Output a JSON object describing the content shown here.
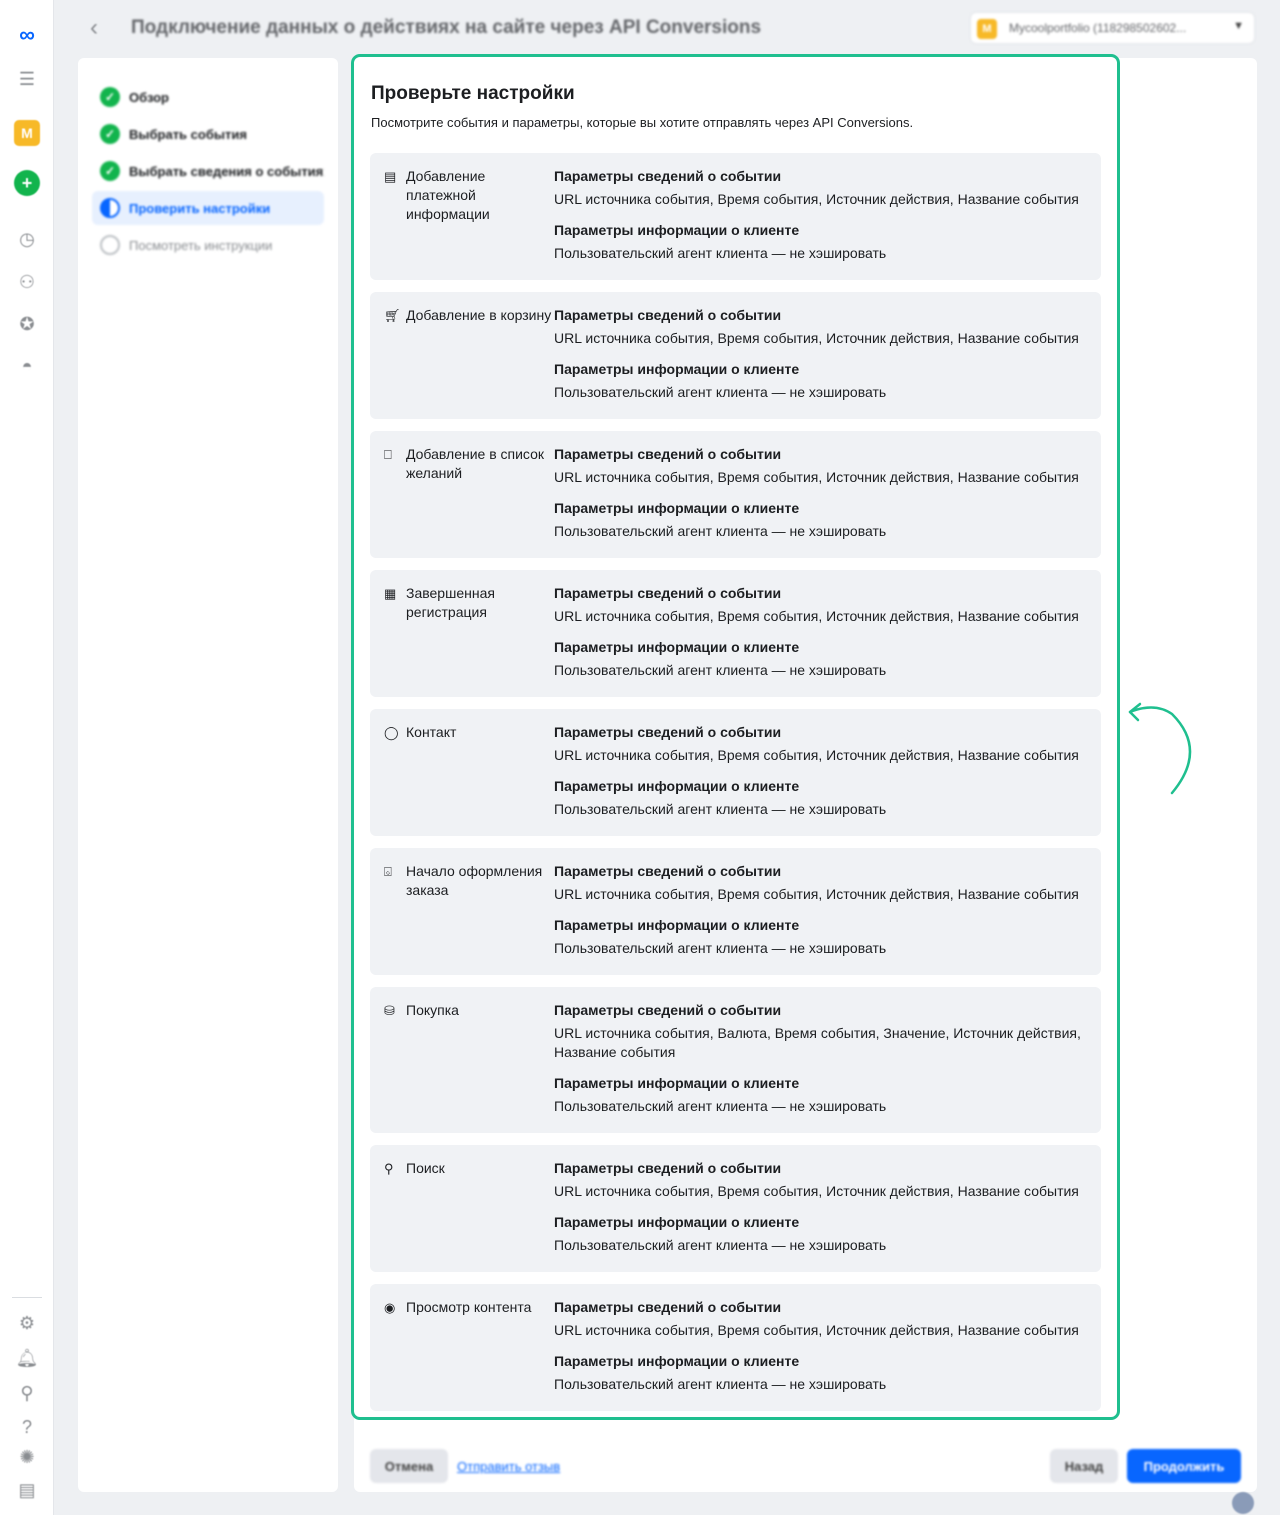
{
  "header": {
    "title": "Подключение данных о действиях на сайте через API Conversions",
    "account_badge": "M",
    "account_name": "Mycoolportfolio (118298502602..."
  },
  "rail": {
    "logo": "∞",
    "account_initial": "M",
    "icons": [
      "menu-icon",
      "clock-icon",
      "network-icon",
      "star-icon",
      "hat-icon",
      "gear-icon",
      "bell-icon",
      "search-icon",
      "help-icon",
      "bug-icon",
      "panel-icon"
    ]
  },
  "steps": [
    {
      "label": "Обзор",
      "state": "done"
    },
    {
      "label": "Выбрать события",
      "state": "done"
    },
    {
      "label": "Выбрать сведения о событиях",
      "state": "done"
    },
    {
      "label": "Проверить настройки",
      "state": "active"
    },
    {
      "label": "Посмотреть инструкции",
      "state": "todo"
    }
  ],
  "panel": {
    "title": "Проверьте настройки",
    "subtitle": "Посмотрите события и параметры, которые вы хотите отправлять через API Conversions."
  },
  "events": [
    {
      "name": "Добавление платежной информации",
      "icon": "card-icon",
      "event_params_label": "Параметры сведений о событии",
      "event_params": "URL источника события, Время события, Источник действия, Название события",
      "customer_params_label": "Параметры информации о клиенте",
      "customer_params": "Пользовательский агент клиента — не хэшировать"
    },
    {
      "name": "Добавление в корзину",
      "icon": "cart-icon",
      "event_params_label": "Параметры сведений о событии",
      "event_params": "URL источника события, Время события, Источник действия, Название события",
      "customer_params_label": "Параметры информации о клиенте",
      "customer_params": "Пользовательский агент клиента — не хэшировать"
    },
    {
      "name": "Добавление в список желаний",
      "icon": "bookmark-icon",
      "event_params_label": "Параметры сведений о событии",
      "event_params": "URL источника события, Время события, Источник действия, Название события",
      "customer_params_label": "Параметры информации о клиенте",
      "customer_params": "Пользовательский агент клиента — не хэшировать"
    },
    {
      "name": "Завершенная регистрация",
      "icon": "form-icon",
      "event_params_label": "Параметры сведений о событии",
      "event_params": "URL источника события, Время события, Источник действия, Название события",
      "customer_params_label": "Параметры информации о клиенте",
      "customer_params": "Пользовательский агент клиента — не хэшировать"
    },
    {
      "name": "Контакт",
      "icon": "chat-icon",
      "event_params_label": "Параметры сведений о событии",
      "event_params": "URL источника события, Время события, Источник действия, Название события",
      "customer_params_label": "Параметры информации о клиенте",
      "customer_params": "Пользовательский агент клиента — не хэшировать"
    },
    {
      "name": "Начало оформления заказа",
      "icon": "basket-icon",
      "event_params_label": "Параметры сведений о событии",
      "event_params": "URL источника события, Время события, Источник действия, Название события",
      "customer_params_label": "Параметры информации о клиенте",
      "customer_params": "Пользовательский агент клиента — не хэшировать"
    },
    {
      "name": "Покупка",
      "icon": "bag-icon",
      "event_params_label": "Параметры сведений о событии",
      "event_params": "URL источника события, Валюта, Время события, Значение, Источник действия, Название события",
      "customer_params_label": "Параметры информации о клиенте",
      "customer_params": "Пользовательский агент клиента — не хэшировать"
    },
    {
      "name": "Поиск",
      "icon": "search-icon",
      "event_params_label": "Параметры сведений о событии",
      "event_params": "URL источника события, Время события, Источник действия, Название события",
      "customer_params_label": "Параметры информации о клиенте",
      "customer_params": "Пользовательский агент клиента — не хэшировать"
    },
    {
      "name": "Просмотр контента",
      "icon": "eye-icon",
      "event_params_label": "Параметры сведений о событии",
      "event_params": "URL источника события, Время события, Источник действия, Название события",
      "customer_params_label": "Параметры информации о клиенте",
      "customer_params": "Пользовательский агент клиента — не хэшировать"
    }
  ],
  "footer": {
    "cancel": "Отмена",
    "feedback": "Отправить отзыв",
    "back": "Назад",
    "continue": "Продолжить"
  },
  "colors": {
    "highlight": "#1fbf8f",
    "primary": "#0866ff",
    "done": "#12b44d",
    "card_bg": "#f0f2f5"
  }
}
